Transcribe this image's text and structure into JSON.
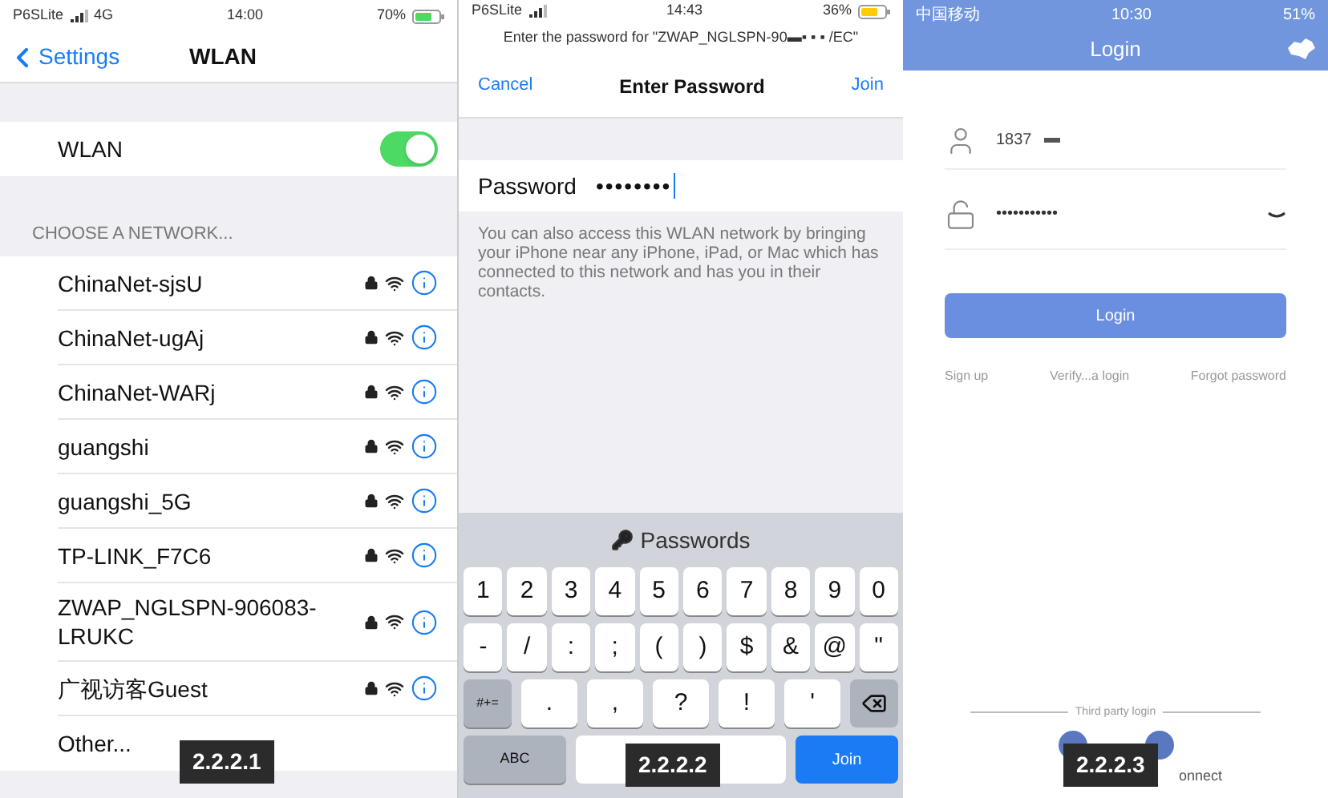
{
  "wlan_screen": {
    "status_bar": {
      "carrier": "P6SLite",
      "network": "4G",
      "time": "14:00",
      "battery": "70%"
    },
    "back_label": "Settings",
    "title": "WLAN",
    "wlan_row": {
      "label": "WLAN",
      "on": true
    },
    "section_header": "CHOOSE A NETWORK...",
    "networks": [
      "ChinaNet-sjsU",
      "ChinaNet-ugAj",
      "ChinaNet-WARj",
      "guangshi",
      "guangshi_5G",
      "TP-LINK_F7C6",
      "ZWAP_NGLSPN-906083-LRUKC",
      "广视访客Guest"
    ],
    "other": "Other...",
    "caption": "2.2.2.1"
  },
  "password_screen": {
    "status_bar": {
      "carrier": "P6SLite",
      "time": "14:43",
      "battery": "36%"
    },
    "prompt": "Enter the password for \"ZWAP_NGLSPN-90▬▪ ▪ ▪ /EC\"",
    "cancel": "Cancel",
    "title": "Enter Password",
    "join": "Join",
    "password_label": "Password",
    "password_value": "••••••••",
    "hint": "You can also access this WLAN network by bringing your iPhone near any iPhone, iPad, or Mac which has connected to this network and has you in their contacts.",
    "keyboard": {
      "suggestion": "Passwords",
      "digit_row": [
        "1",
        "2",
        "3",
        "4",
        "5",
        "6",
        "7",
        "8",
        "9",
        "0"
      ],
      "symbol_row": [
        "-",
        "/",
        ":",
        ";",
        "(",
        ")",
        "$",
        "&",
        "@",
        "\""
      ],
      "mode_key": "#+=",
      "punct_row": [
        ".",
        ",",
        "?",
        "!",
        "'"
      ],
      "abc_key": "ABC",
      "join_key": "Join"
    },
    "caption": "2.2.2.2"
  },
  "login_screen": {
    "status_bar": {
      "carrier": "中国移动",
      "time": "10:30",
      "battery": "51%"
    },
    "title": "Login",
    "username": "1837",
    "password": "•••••••••••",
    "login_button": "Login",
    "links": [
      "Sign up",
      "Verify...a login",
      "Forgot password"
    ],
    "third_party": "Third party login",
    "connect_fragment": "onnect",
    "caption": "2.2.2.3"
  }
}
